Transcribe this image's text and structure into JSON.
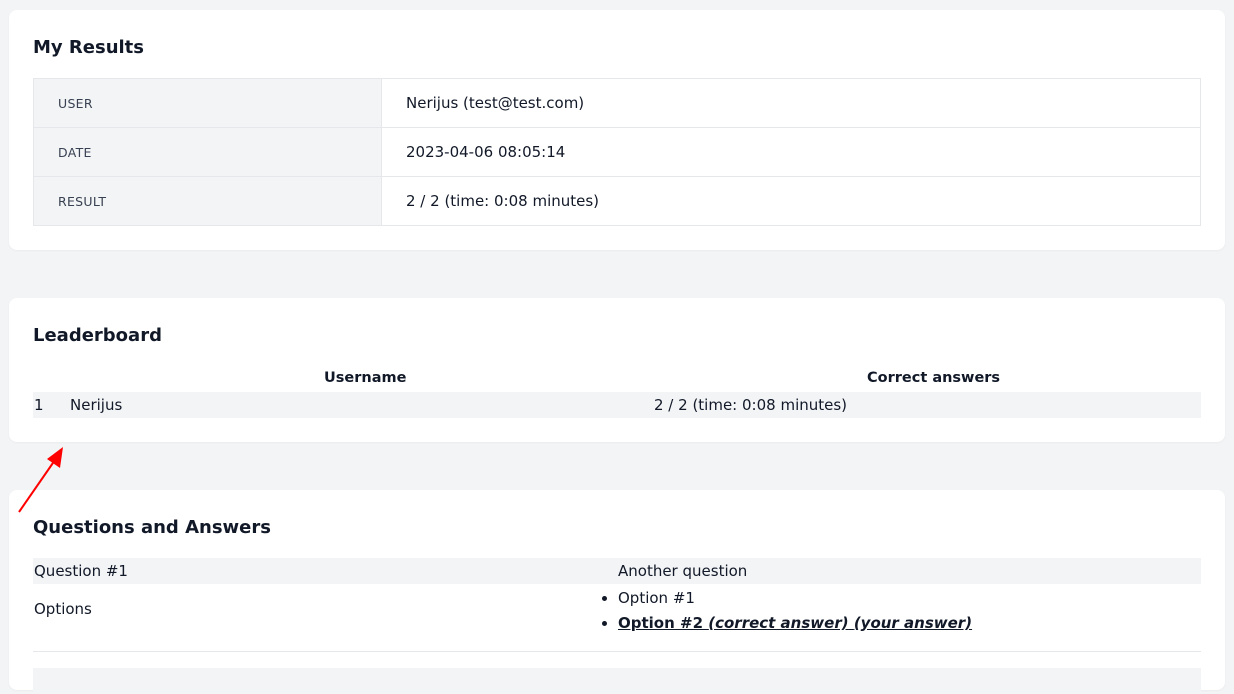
{
  "results": {
    "title": "My Results",
    "rows": [
      {
        "label": "USER",
        "value": "Nerijus (test@test.com)"
      },
      {
        "label": "DATE",
        "value": "2023-04-06 08:05:14"
      },
      {
        "label": "RESULT",
        "value": "2 / 2 (time: 0:08 minutes)"
      }
    ]
  },
  "leaderboard": {
    "title": "Leaderboard",
    "headers": {
      "username": "Username",
      "correct": "Correct answers"
    },
    "rows": [
      {
        "rank": "1",
        "username": "Nerijus",
        "correct": "2 / 2 (time: 0:08 minutes)"
      }
    ]
  },
  "qa": {
    "title": "Questions and Answers",
    "question_label": "Question #1",
    "question_text": "Another question",
    "options_label": "Options",
    "options": [
      {
        "text": "Option #1"
      },
      {
        "text": "Option #2",
        "correct_tag": "(correct answer)",
        "your_tag": "(your answer)"
      }
    ]
  },
  "annotation": {
    "color": "#ff0000",
    "icon": "red-arrow-icon"
  }
}
